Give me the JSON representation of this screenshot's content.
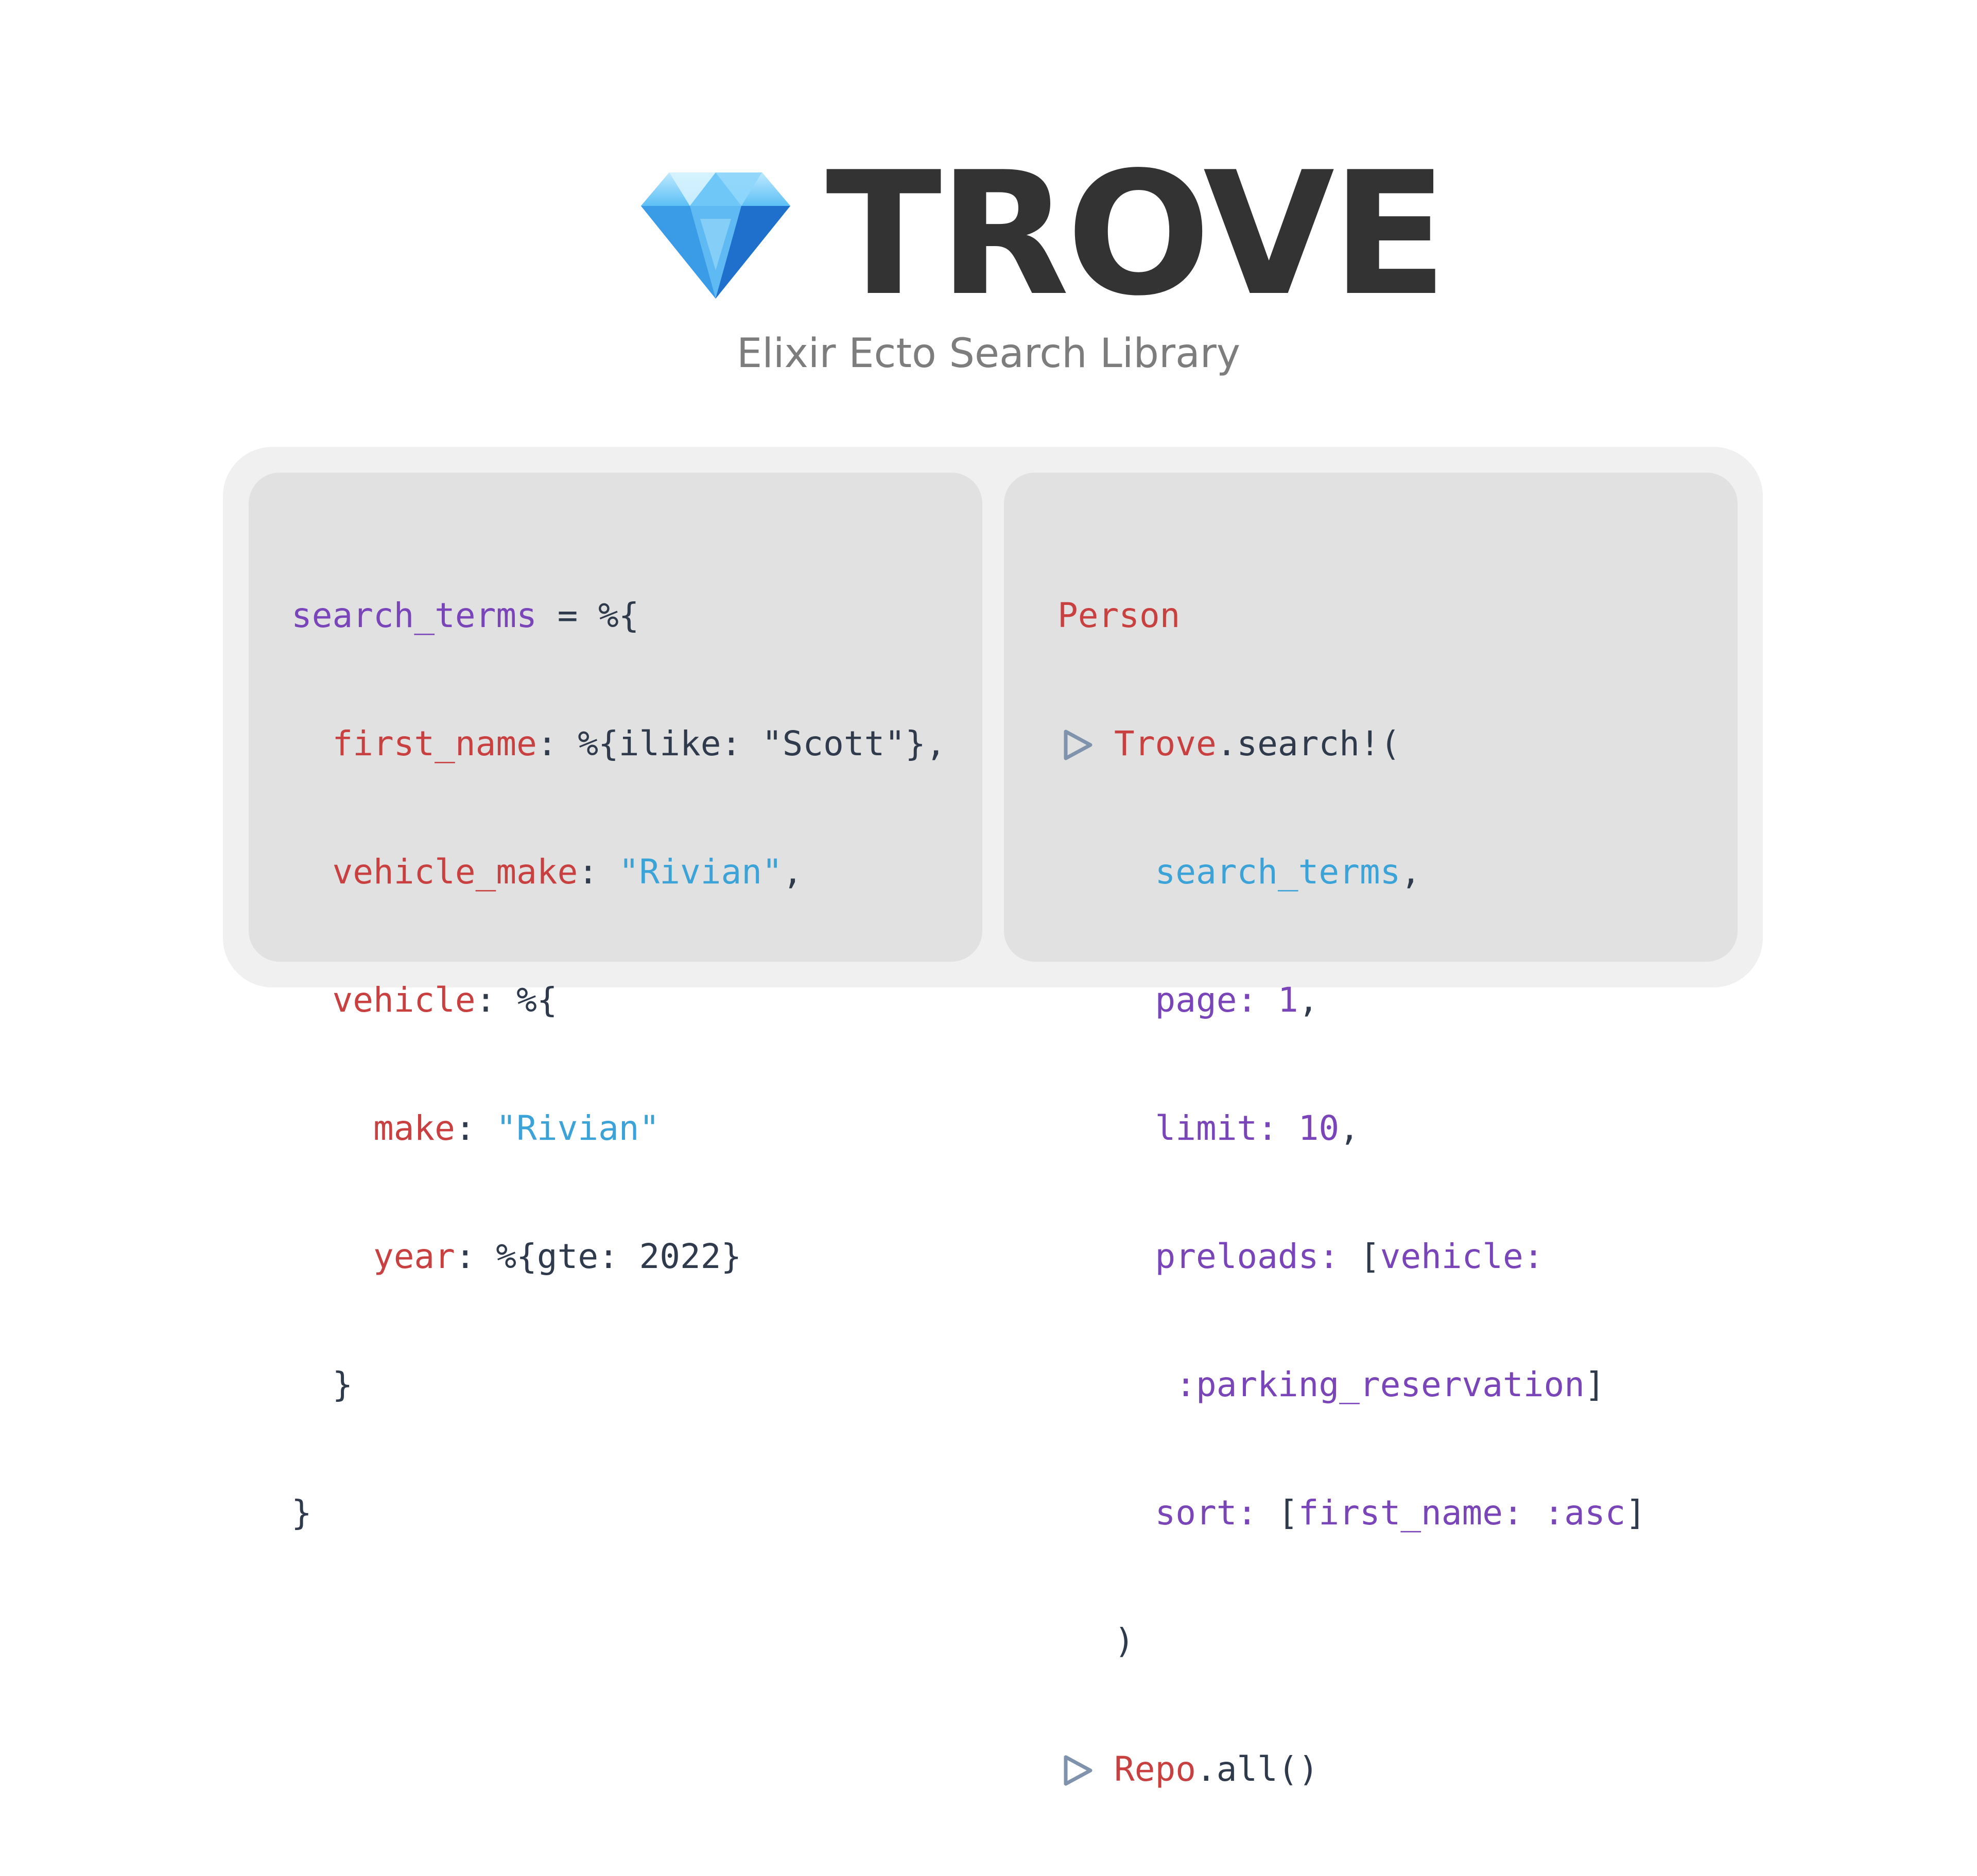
{
  "header": {
    "title": "TROVE",
    "subtitle": "Elixir Ecto Search Library",
    "logo_icon": "gem-icon",
    "title_color": "#333333"
  },
  "colors": {
    "variable": "#7a45b8",
    "key": "#c94040",
    "string": "#3ba3d8",
    "plain": "#2f3b4d",
    "panel_bg": "#e1e1e1",
    "frame_bg": "#f0f0f0"
  },
  "left_code": {
    "l1_var": "search_terms",
    "l1_rest": " = %{",
    "l2_indent": "  ",
    "l2_key": "first_name",
    "l2_rest": ": %{ilike: \"Scott\"},",
    "l3_indent": "  ",
    "l3_key": "vehicle_make",
    "l3_sep": ": ",
    "l3_str": "\"Rivian\"",
    "l3_end": ",",
    "l4_indent": "  ",
    "l4_key": "vehicle",
    "l4_rest": ": %{",
    "l5_indent": "    ",
    "l5_key": "make",
    "l5_sep": ": ",
    "l5_str": "\"Rivian\"",
    "l6_indent": "    ",
    "l6_key": "year",
    "l6_rest": ": %{gte: 2022}",
    "l7": "  }",
    "l8": "}"
  },
  "right_code": {
    "l1_mod": "Person",
    "pipe_icon": "pipe-triangle-icon",
    "l2_mod": "Trove",
    "l2_rest": ".search!(",
    "l3_indent": "  ",
    "l3_arg": "search_terms",
    "l3_end": ",",
    "l4_indent": "  ",
    "l4_opt": "page: 1",
    "l4_end": ",",
    "l5_indent": "  ",
    "l5_opt": "limit: 10",
    "l5_end": ",",
    "l6_indent": "  ",
    "l6_opt": "preloads:",
    "l6_open": " [",
    "l6_opt2": "vehicle:",
    "l7_indent": "   ",
    "l7_opt": ":parking_reservation",
    "l7_close": "]",
    "l8_indent": "  ",
    "l8_opt": "sort:",
    "l8_open": " [",
    "l8_opt2": "first_name: :asc",
    "l8_close": "]",
    "l9": ")",
    "l10_mod": "Repo",
    "l10_rest": ".all()"
  }
}
